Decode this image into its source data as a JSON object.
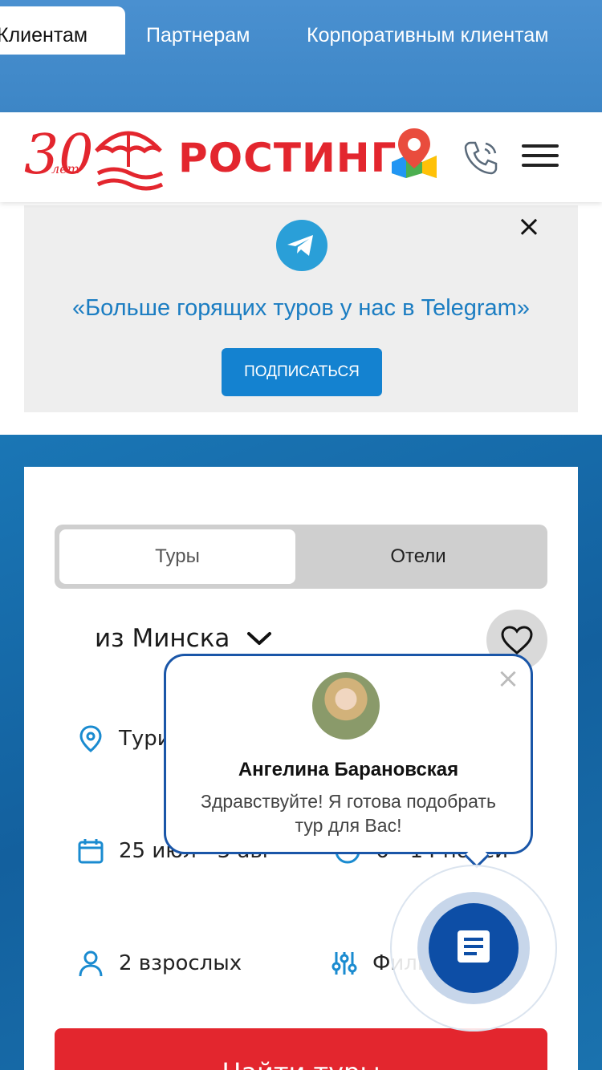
{
  "topnav": {
    "tabs": [
      {
        "label": "Клиентам",
        "active": true
      },
      {
        "label": "Партнерам",
        "active": false
      },
      {
        "label": "Корпоративным клиентам",
        "active": false
      }
    ]
  },
  "header": {
    "logo_years": "30",
    "logo_sub": "лет",
    "brand": "РОСТИНГ"
  },
  "telegram_banner": {
    "text": "«Больше горящих туров у нас в Telegram»",
    "button": "ПОДПИСАТЬСЯ",
    "close": "×"
  },
  "search": {
    "tabs": [
      {
        "label": "Туры",
        "active": true
      },
      {
        "label": "Отели",
        "active": false
      }
    ],
    "from_city": "из Минска",
    "destination": "Тури",
    "dates": "25 июл - 3 авг",
    "nights": "6 - 14 ночей",
    "tourists": "2 взрослых",
    "filters": "Фильтры",
    "submit": "Найти туры"
  },
  "chat": {
    "agent_name": "Ангелина Барановская",
    "message": "Здравствуйте! Я готова подобрать тур для Вас!",
    "close": "×"
  },
  "colors": {
    "nav_blue": "#428bca",
    "brand_red": "#e3262e",
    "telegram_blue": "#2a9fd8",
    "link_blue": "#1b7dc2",
    "search_bg": "#1766a5",
    "chat_blue": "#0d4ea6"
  },
  "icons": [
    "map-pin-icon",
    "phone-icon",
    "menu-icon",
    "telegram-icon",
    "close-icon",
    "chevron-down-icon",
    "heart-icon",
    "location-icon",
    "calendar-icon",
    "clock-icon",
    "user-icon",
    "filter-icon",
    "chat-icon"
  ]
}
